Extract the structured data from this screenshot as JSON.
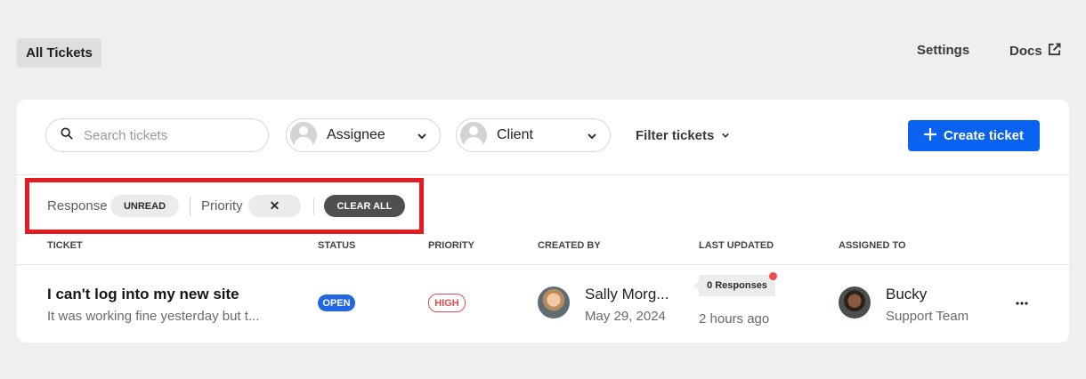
{
  "tabs": {
    "all_tickets": "All Tickets"
  },
  "top_nav": {
    "settings": "Settings",
    "docs": "Docs"
  },
  "toolbar": {
    "search_placeholder": "Search tickets",
    "assignee": "Assignee",
    "client": "Client",
    "filter_tickets": "Filter tickets",
    "create_ticket": "Create ticket"
  },
  "active_filters": {
    "response_label": "Response",
    "response_value": "UNREAD",
    "priority_label": "Priority",
    "priority_value": "✕",
    "clear_all": "CLEAR ALL"
  },
  "table": {
    "headers": {
      "ticket": "TICKET",
      "status": "STATUS",
      "priority": "PRIORITY",
      "created_by": "CREATED BY",
      "last_updated": "LAST UPDATED",
      "assigned_to": "ASSIGNED TO"
    },
    "rows": [
      {
        "title": "I can't log into my new site",
        "excerpt": "It was working fine yesterday but t...",
        "status": "OPEN",
        "priority": "HIGH",
        "created_by_name": "Sally Morg...",
        "created_date": "May 29, 2024",
        "responses": "0 Responses",
        "updated": "2 hours ago",
        "assignee_name": "Bucky",
        "assignee_team": "Support Team"
      }
    ]
  },
  "colors": {
    "primary": "#0a62f0",
    "open": "#2266e3",
    "high": "#e5484d",
    "highlight": "#e21b23"
  }
}
